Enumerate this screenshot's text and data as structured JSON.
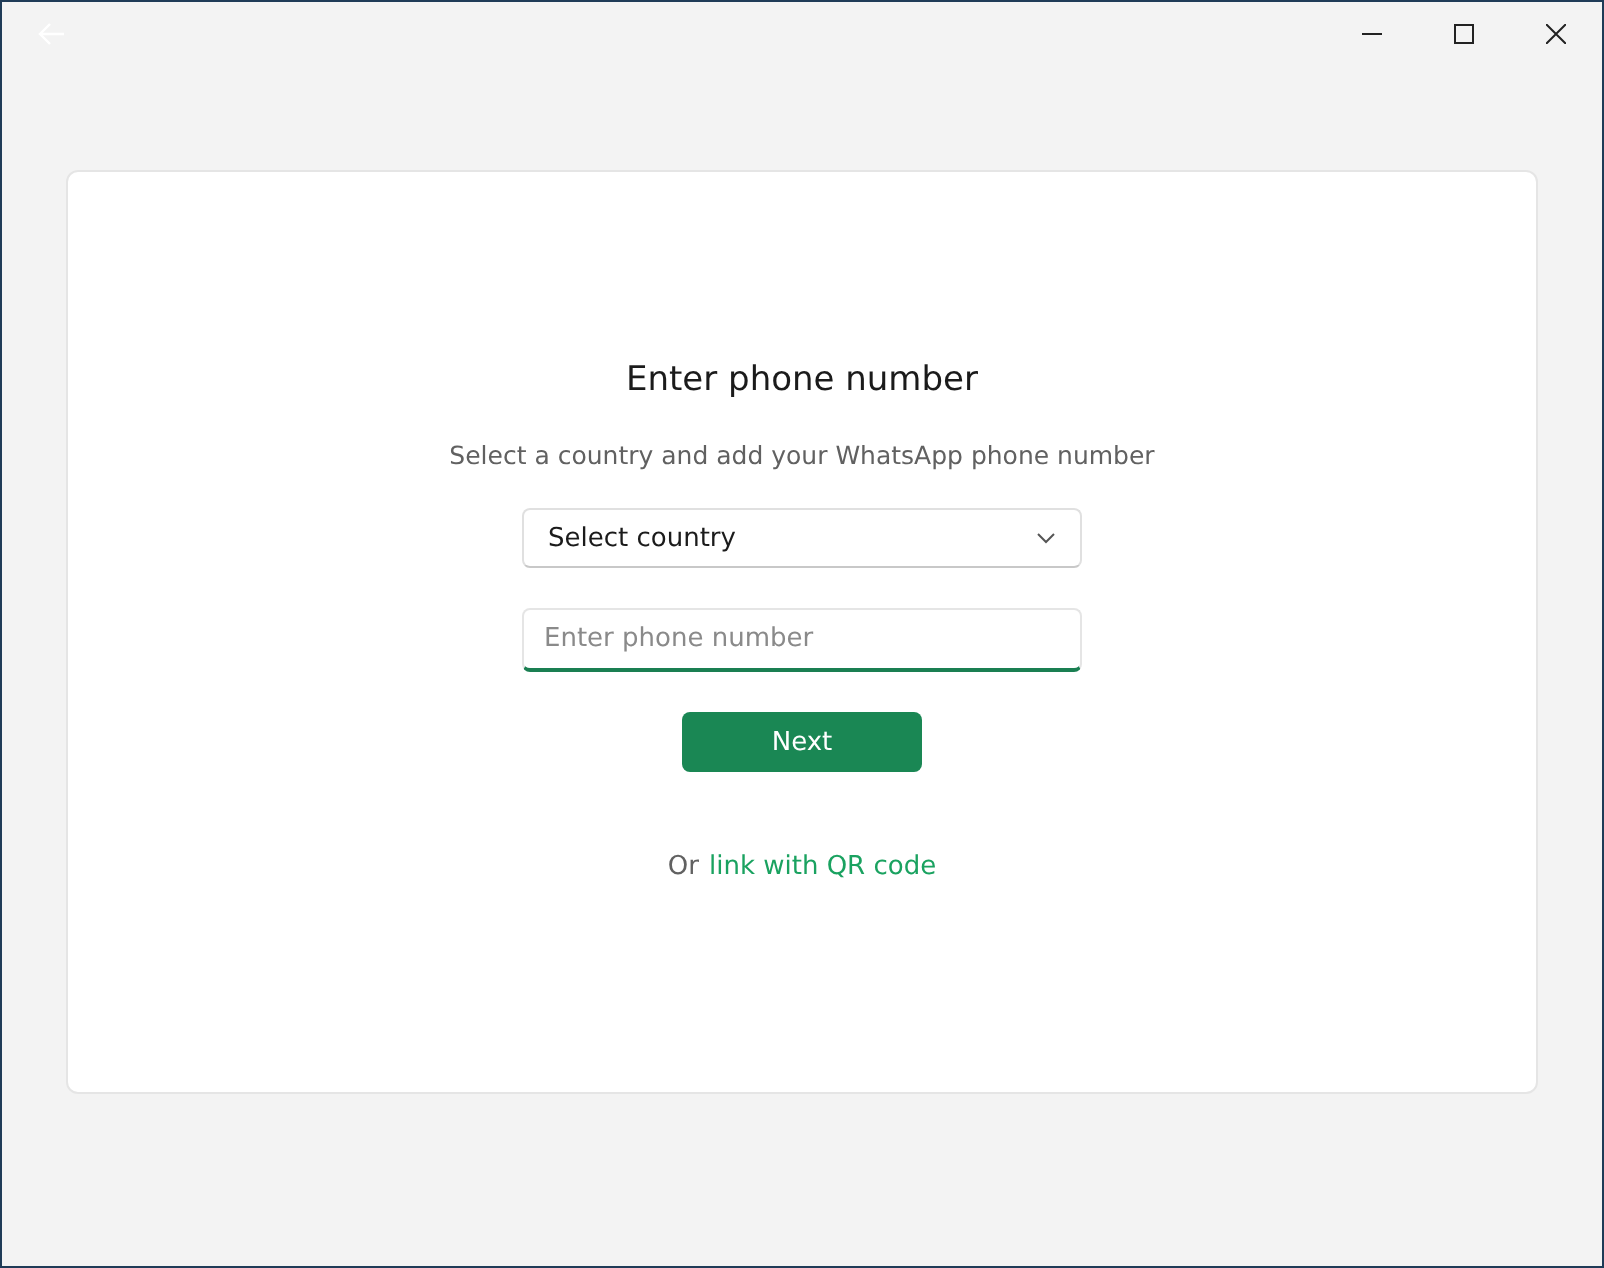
{
  "title_bar": {
    "back_disabled": true
  },
  "card": {
    "title": "Enter phone number",
    "subtitle": "Select a country and add your WhatsApp phone number",
    "country_select": {
      "value": "Select country"
    },
    "phone_field": {
      "placeholder": "Enter phone number",
      "focused": true
    },
    "next_button": {
      "label": "Next"
    },
    "qr_prompt": {
      "prefix": "Or",
      "link": "link with QR code"
    }
  }
}
